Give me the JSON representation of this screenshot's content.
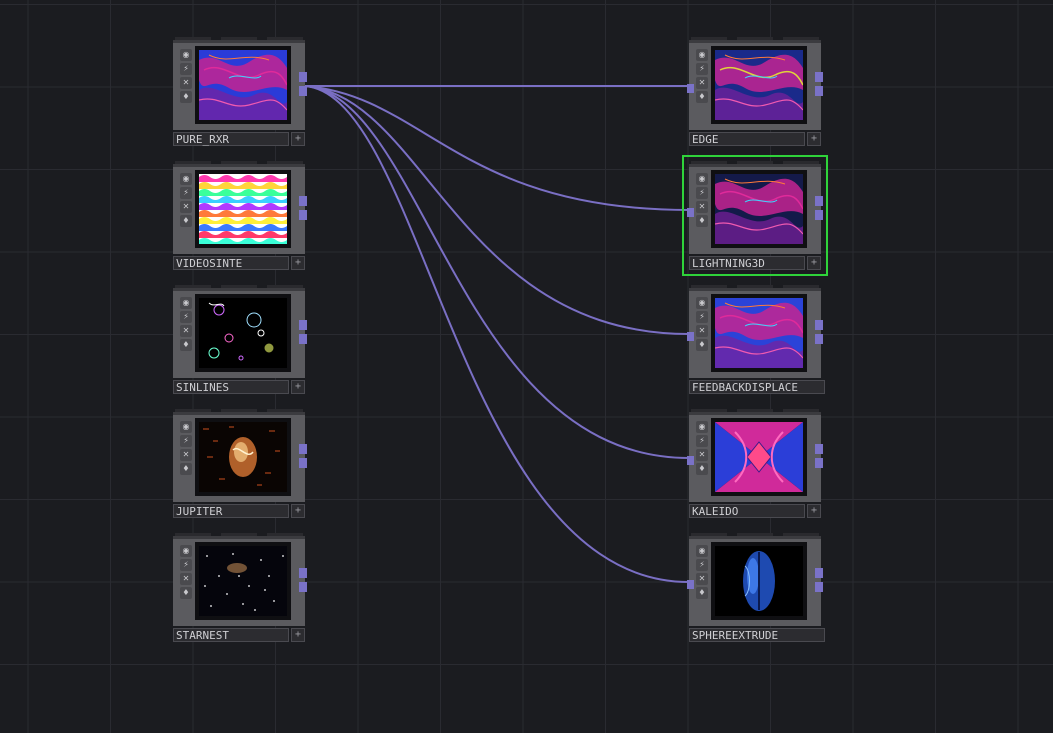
{
  "network": {
    "nodes_left": [
      {
        "id": "pure_rxr",
        "label": "PURE_RXR",
        "thumb": "marble-blue-magenta"
      },
      {
        "id": "videosinte",
        "label": "VIDEOSINTE",
        "thumb": "rainbow-waves"
      },
      {
        "id": "sinlines",
        "label": "SINLINES",
        "thumb": "neon-circles"
      },
      {
        "id": "jupiter",
        "label": "JUPITER",
        "thumb": "orange-planet"
      },
      {
        "id": "starnest",
        "label": "STARNEST",
        "thumb": "starfield"
      }
    ],
    "nodes_right": [
      {
        "id": "edge",
        "label": "EDGE",
        "thumb": "marble-edge",
        "selected": false
      },
      {
        "id": "lightning3d",
        "label": "LIGHTNING3D",
        "thumb": "marble-dark",
        "selected": true
      },
      {
        "id": "feedbackdisplace",
        "label": "FEEDBACKDISPLACE",
        "thumb": "marble-feedback",
        "selected": false
      },
      {
        "id": "kaleido",
        "label": "KALEIDO",
        "thumb": "kaleidoscope",
        "selected": false
      },
      {
        "id": "sphereextrude",
        "label": "SPHEREEXTRUDE",
        "thumb": "blue-sphere",
        "selected": false
      }
    ],
    "connections": [
      {
        "from": "pure_rxr",
        "to": "edge"
      },
      {
        "from": "pure_rxr",
        "to": "lightning3d"
      },
      {
        "from": "pure_rxr",
        "to": "feedbackdisplace"
      },
      {
        "from": "pure_rxr",
        "to": "kaleido"
      },
      {
        "from": "pure_rxr",
        "to": "sphereextrude"
      }
    ],
    "side_buttons": [
      "viewer-icon",
      "bypass-icon",
      "cook-off-icon",
      "lock-icon"
    ],
    "colors": {
      "wire": "#7a6fc4",
      "selection": "#2fd33a",
      "background": "#1b1c20"
    }
  }
}
